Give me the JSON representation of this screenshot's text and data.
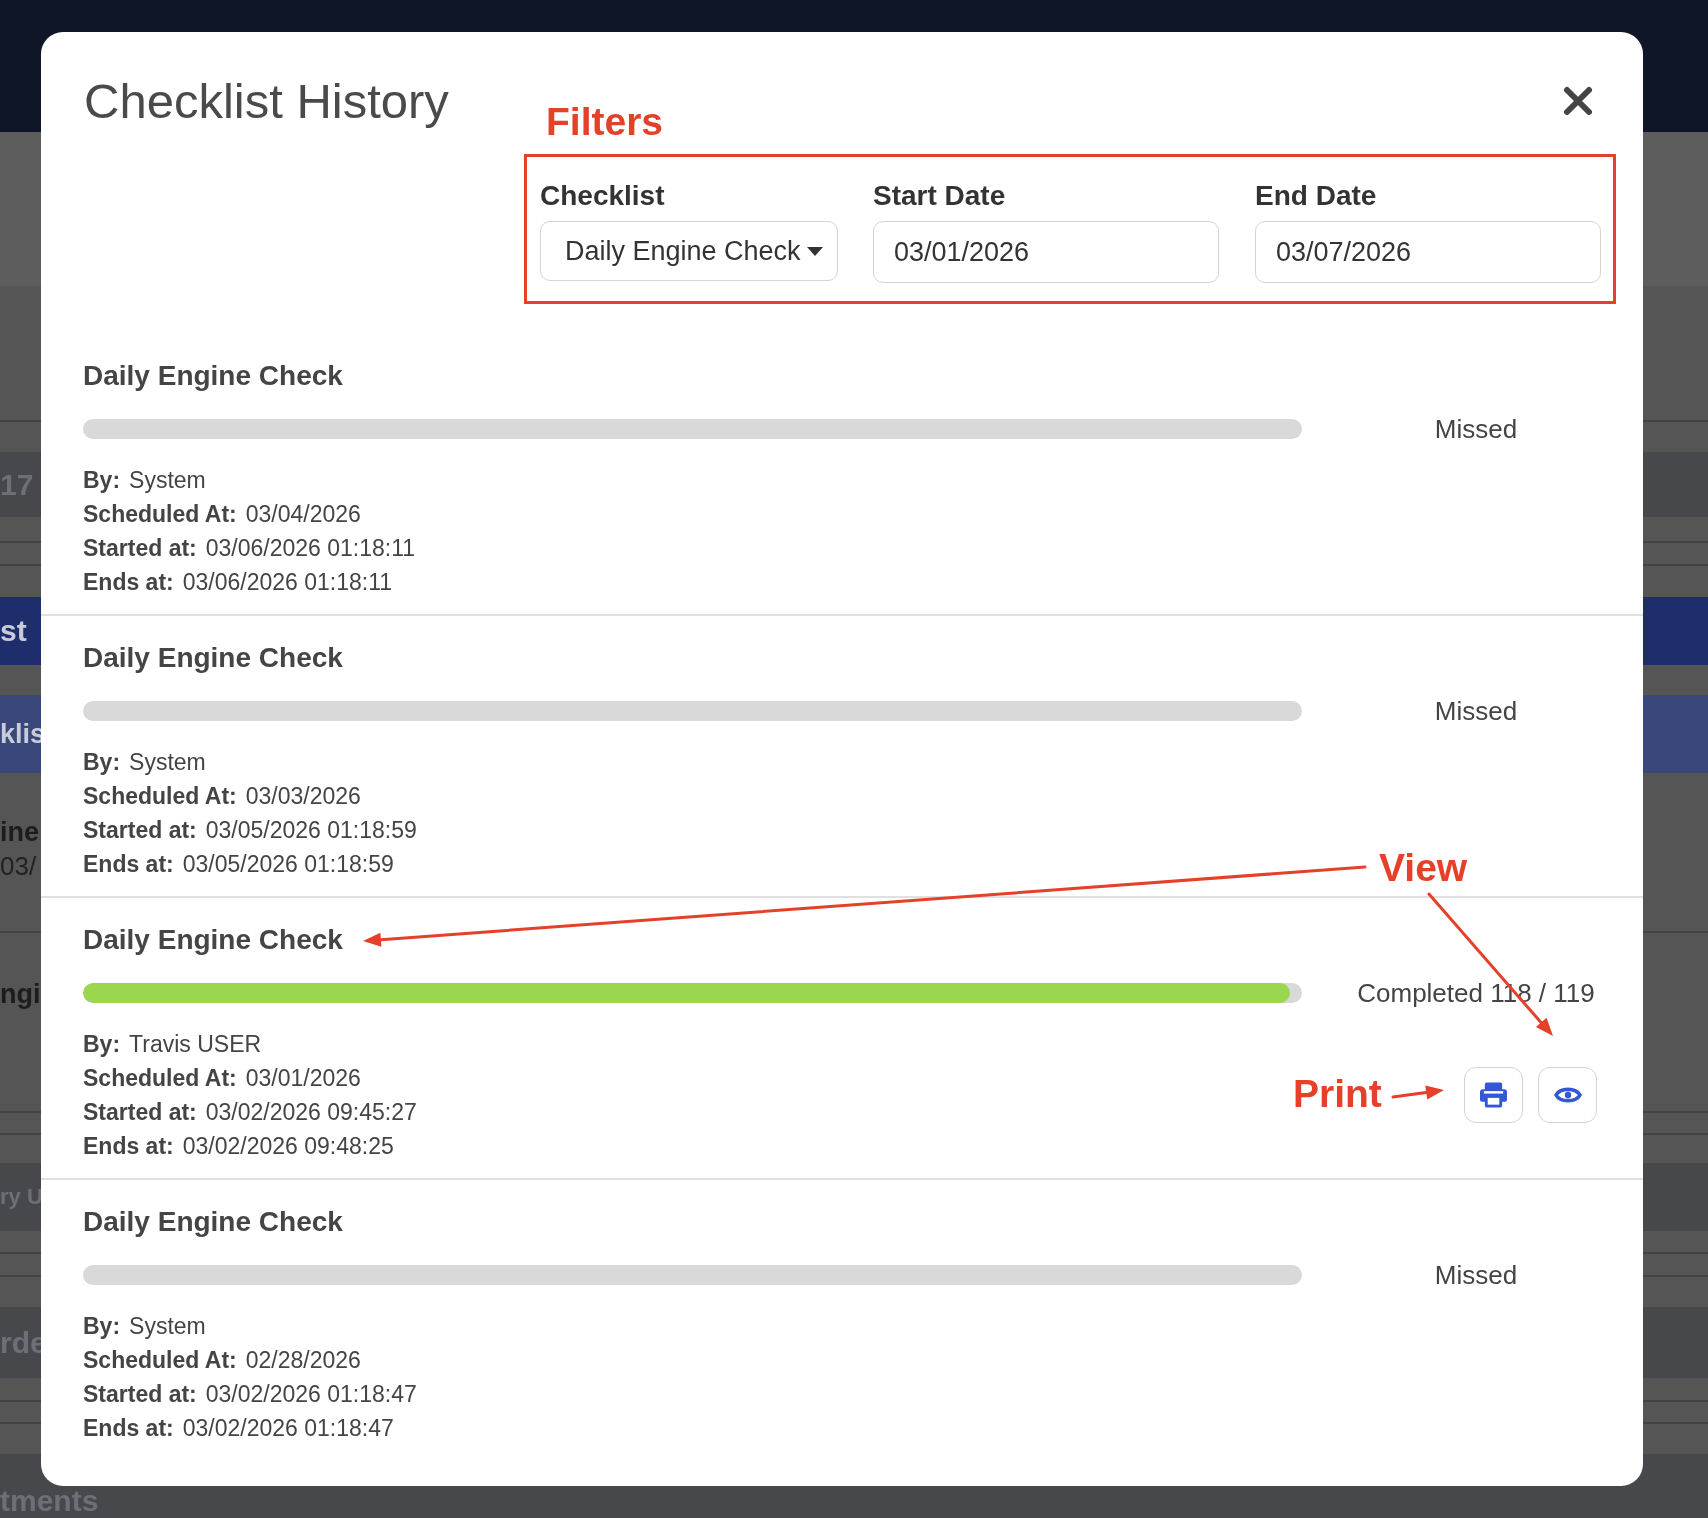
{
  "background": {
    "fragments": [
      {
        "text": "17",
        "kind": "dark_band"
      },
      {
        "text": "st",
        "kind": "blue_band"
      },
      {
        "text": "klis",
        "kind": "slate_band"
      },
      {
        "text": "ine",
        "kind": "bold"
      },
      {
        "text": "03/",
        "kind": "regular"
      },
      {
        "text": "ngi",
        "kind": "bold"
      },
      {
        "text": "ry U",
        "kind": "dark_band"
      },
      {
        "text": "rde",
        "kind": "dark_band"
      },
      {
        "text": "tments",
        "kind": "dark_band"
      }
    ]
  },
  "modal": {
    "title": "Checklist History",
    "filters": [
      {
        "label": "Checklist",
        "kind": "select",
        "value": "Daily Engine Check"
      },
      {
        "label": "Start Date",
        "kind": "date",
        "value": "03/01/2026"
      },
      {
        "label": "End Date",
        "kind": "date",
        "value": "03/07/2026"
      }
    ],
    "entries": [
      {
        "title": "Daily Engine Check",
        "level": 0,
        "status": "Missed",
        "details": [
          {
            "label": "By:",
            "value": "System"
          },
          {
            "label": "Scheduled At:",
            "value": "03/04/2026"
          },
          {
            "label": "Started at:",
            "value": "03/06/2026 01:18:11"
          },
          {
            "label": "Ends at:",
            "value": "03/06/2026 01:18:11"
          }
        ],
        "buttons_shown": false
      },
      {
        "title": "Daily Engine Check",
        "level": 0,
        "status": "Missed",
        "details": [
          {
            "label": "By:",
            "value": "System"
          },
          {
            "label": "Scheduled At:",
            "value": "03/03/2026"
          },
          {
            "label": "Started at:",
            "value": "03/05/2026 01:18:59"
          },
          {
            "label": "Ends at:",
            "value": "03/05/2026 01:18:59"
          }
        ],
        "buttons_shown": false
      },
      {
        "title": "Daily Engine Check",
        "level": 0.99,
        "status": "Completed 118 / 119",
        "details": [
          {
            "label": "By:",
            "value": "Travis USER"
          },
          {
            "label": "Scheduled At:",
            "value": "03/01/2026"
          },
          {
            "label": "Started at:",
            "value": "03/02/2026 09:45:27"
          },
          {
            "label": "Ends at:",
            "value": "03/02/2026 09:48:25"
          }
        ],
        "buttons_shown": true
      },
      {
        "title": "Daily Engine Check",
        "level": 0,
        "status": "Missed",
        "details": [
          {
            "label": "By:",
            "value": "System"
          },
          {
            "label": "Scheduled At:",
            "value": "02/28/2026"
          },
          {
            "label": "Started at:",
            "value": "03/02/2026 01:18:47"
          },
          {
            "label": "Ends at:",
            "value": "03/02/2026 01:18:47"
          }
        ],
        "buttons_shown": false
      }
    ]
  },
  "annotations": [
    {
      "kind": "frame",
      "text": "Filters"
    },
    {
      "kind": "arrow",
      "text": "View"
    },
    {
      "kind": "arrow",
      "text": "Print"
    }
  ]
}
